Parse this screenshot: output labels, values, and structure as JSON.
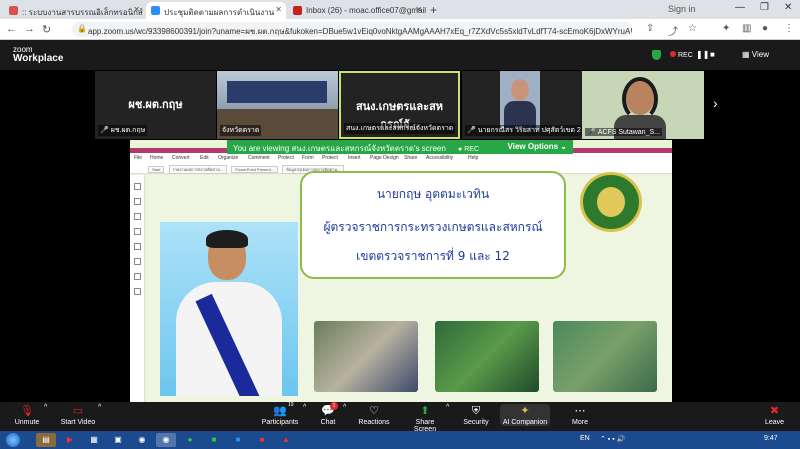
{
  "browser": {
    "tabs": [
      {
        "title": ":: ระบบงานสารบรรณอิเล็กทรอนิกส์",
        "color": "#d9534f",
        "active": false
      },
      {
        "title": "ประชุมติดตามผลการดำเนินงาน",
        "color": "#2d8cff",
        "active": true
      },
      {
        "title": "Inbox (26) - moac.office07@gmail",
        "color": "#c5221f",
        "active": false
      }
    ],
    "new_tab": "+",
    "sign_up": "Sign in",
    "url": "app.zoom.us/wc/93398600391/join?uname=ผช.ผต.กฤษ&fukoken=DBue5w1vEiq0voNktgAAMgAAAH7xEq_r7ZXdVc5s5xldTvLdfT74-scEmoK6jDxWYruAU..."
  },
  "zoom": {
    "logo_line1": "zoom",
    "logo_line2": "Workplace",
    "rec_label": "REC",
    "view_label": "View"
  },
  "participants": [
    {
      "display": "ผช.ผต.กฤษ",
      "label": "ผช.ผต.กฤษ",
      "muted": true,
      "highlight": false
    },
    {
      "display": "",
      "label": "จังหวัดตราด",
      "muted": false,
      "highlight": false
    },
    {
      "display": "สนง.เกษตรและสหกรณ์จั...",
      "label": "สนง.เกษตรและสหกรณ์จังหวัดตราด",
      "muted": false,
      "highlight": true
    },
    {
      "display": "",
      "label": "นายกรณีสร วิริยสาท ปศุสัตว์เขต 2",
      "muted": true,
      "highlight": false
    },
    {
      "display": "",
      "label": "ACFS Sutawan_S...",
      "muted": true,
      "highlight": false
    }
  ],
  "share": {
    "banner_text": "You are viewing สนง.เกษตรและสหกรณ์จังหวัดตราด's screen",
    "banner_rec": "REC",
    "view_options": "View Options ⌄",
    "menu": [
      "File",
      "Home",
      "Convert",
      "Edit",
      "Organize",
      "Comment",
      "Protect",
      "Form",
      "Protect",
      "Insert",
      "Page Design",
      "Share",
      "Accessibility",
      "Help"
    ],
    "doc_tabs": [
      "Start",
      "รายงานผลการตรวจติดตาม...",
      "PowerPoint Present...",
      "ข้อมูลสรุปผลการตรวจติดตาม..."
    ]
  },
  "slide": {
    "title_line1": "นายกฤษ  อุตตมะเวทิน",
    "title_line2": "ผู้ตรวจราชการกระทรวงเกษตรและสหกรณ์",
    "title_line3": "เขตตรวจราชการที่ 9 และ 12"
  },
  "toolbar": {
    "unmute": "Unmute",
    "start_video": "Start Video",
    "participants": "Participants",
    "participants_count": "19",
    "chat": "Chat",
    "chat_badge": "1",
    "reactions": "Reactions",
    "share_screen": "Share Screen",
    "security": "Security",
    "ai_companion": "AI Companion",
    "more": "More",
    "leave": "Leave"
  },
  "taskbar": {
    "lang": "EN",
    "time": "9:47"
  },
  "colors": {
    "zoom_green": "#27a745",
    "slide_green": "#8cbc4a",
    "title_blue": "#1f3a9a",
    "rec_red": "#e02828"
  }
}
